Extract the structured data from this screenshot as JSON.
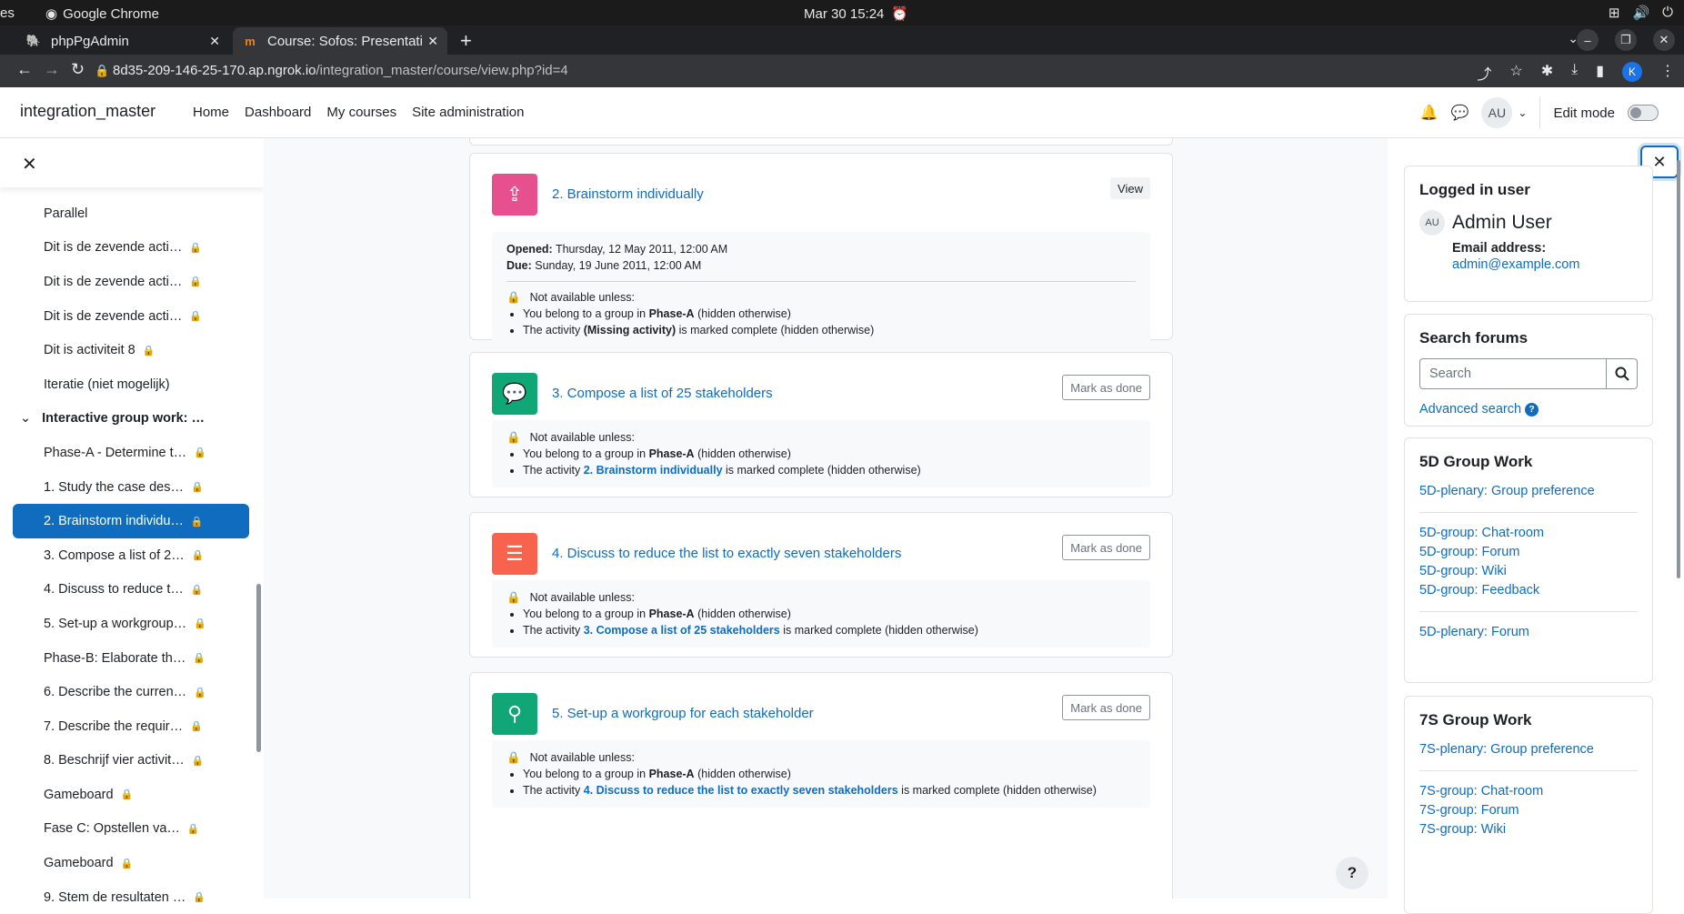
{
  "os": {
    "left_fragment": "es",
    "app_name": "Google Chrome",
    "clock": "Mar 30  15:24"
  },
  "browser": {
    "tabs": [
      {
        "title": "phpPgAdmin",
        "active": false
      },
      {
        "title": "Course: Sofos: Presentati",
        "active": true
      }
    ],
    "url_host": "8d35-209-146-25-170.ap.ngrok.io",
    "url_path": "/integration_master/course/view.php?id=4",
    "profile_initial": "K"
  },
  "navbar": {
    "brand": "integration_master",
    "links": [
      "Home",
      "Dashboard",
      "My courses",
      "Site administration"
    ],
    "user_initials": "AU",
    "edit_mode_label": "Edit mode"
  },
  "course_index": [
    {
      "label": "Parallel",
      "lock": false,
      "type": "item"
    },
    {
      "label": "Dit is de zevende acti…",
      "lock": true,
      "type": "item"
    },
    {
      "label": "Dit is de zevende acti…",
      "lock": true,
      "type": "item"
    },
    {
      "label": "Dit is de zevende acti…",
      "lock": true,
      "type": "item"
    },
    {
      "label": "Dit is activiteit 8",
      "lock": true,
      "type": "item"
    },
    {
      "label": "Iteratie (niet mogelijk)",
      "lock": false,
      "type": "item"
    },
    {
      "label": "Interactive group work: …",
      "lock": false,
      "type": "section"
    },
    {
      "label": "Phase-A - Determine t…",
      "lock": true,
      "type": "item"
    },
    {
      "label": "1. Study the case des…",
      "lock": true,
      "type": "item"
    },
    {
      "label": "2. Brainstorm individu…",
      "lock": true,
      "type": "item",
      "active": true
    },
    {
      "label": "3. Compose a list of 2…",
      "lock": true,
      "type": "item"
    },
    {
      "label": "4. Discuss to reduce t…",
      "lock": true,
      "type": "item"
    },
    {
      "label": "5. Set-up a workgroup…",
      "lock": true,
      "type": "item"
    },
    {
      "label": "Phase-B: Elaborate th…",
      "lock": true,
      "type": "item"
    },
    {
      "label": "6. Describe the curren…",
      "lock": true,
      "type": "item"
    },
    {
      "label": "7. Describe the requir…",
      "lock": true,
      "type": "item"
    },
    {
      "label": "8. Beschrijf vier activit…",
      "lock": true,
      "type": "item"
    },
    {
      "label": "Gameboard",
      "lock": true,
      "type": "item"
    },
    {
      "label": "Fase C: Opstellen va…",
      "lock": true,
      "type": "item"
    },
    {
      "label": "Gameboard",
      "lock": true,
      "type": "item"
    },
    {
      "label": "9. Stem de resultaten …",
      "lock": true,
      "type": "item"
    }
  ],
  "activities": [
    {
      "title": "2. Brainstorm individually",
      "button": "View",
      "icon_color": "#e6508f",
      "opened_label": "Opened:",
      "opened": "Thursday, 12 May 2011, 12:00 AM",
      "due_label": "Due:",
      "due": "Sunday, 19 June 2011, 12:00 AM",
      "not_available": "Not available unless:",
      "r1_pre": "You belong to a group in",
      "r1_group": "Phase-A",
      "r1_post": "(hidden otherwise)",
      "r2_pre": "The activity",
      "r2_act": "(Missing activity)",
      "r2_post": "is marked complete (hidden otherwise)"
    },
    {
      "title": "3. Compose a list of 25 stakeholders",
      "button": "Mark as done",
      "icon_color": "#11a676",
      "not_available": "Not available unless:",
      "r1_pre": "You belong to a group in",
      "r1_group": "Phase-A",
      "r1_post": "(hidden otherwise)",
      "r2_pre": "The activity",
      "r2_act": "2. Brainstorm individually",
      "r2_post": "is marked complete (hidden otherwise)"
    },
    {
      "title": "4. Discuss to reduce the list to exactly seven stakeholders",
      "button": "Mark as done",
      "icon_color": "#f7634d",
      "not_available": "Not available unless:",
      "r1_pre": "You belong to a group in",
      "r1_group": "Phase-A",
      "r1_post": "(hidden otherwise)",
      "r2_pre": "The activity",
      "r2_act": "3. Compose a list of 25 stakeholders",
      "r2_post": "is marked complete (hidden otherwise)"
    },
    {
      "title": "5. Set-up a workgroup for each stakeholder",
      "button": "Mark as done",
      "icon_color": "#11a676",
      "not_available": "Not available unless:",
      "r1_pre": "You belong to a group in",
      "r1_group": "Phase-A",
      "r1_post": "(hidden otherwise)",
      "r2_pre": "The activity",
      "r2_act": "4. Discuss to reduce the list to exactly seven stakeholders",
      "r2_post": "is marked complete (hidden otherwise)"
    }
  ],
  "help_label": "?",
  "blocks": {
    "logged_in": {
      "title": "Logged in user",
      "initials": "AU",
      "name": "Admin User",
      "email_label": "Email address:",
      "email": "admin@example.com"
    },
    "search_forums": {
      "title": "Search forums",
      "placeholder": "Search",
      "advanced": "Advanced search",
      "help": "?"
    },
    "group5d": {
      "title": "5D Group Work",
      "top": "5D-plenary: Group preference",
      "group": [
        "5D-group: Chat-room",
        "5D-group: Forum",
        "5D-group: Wiki",
        "5D-group: Feedback"
      ],
      "bottom": "5D-plenary: Forum"
    },
    "group7s": {
      "title": "7S Group Work",
      "top": "7S-plenary: Group preference",
      "group": [
        "7S-group: Chat-room",
        "7S-group: Forum",
        "7S-group: Wiki"
      ]
    }
  }
}
